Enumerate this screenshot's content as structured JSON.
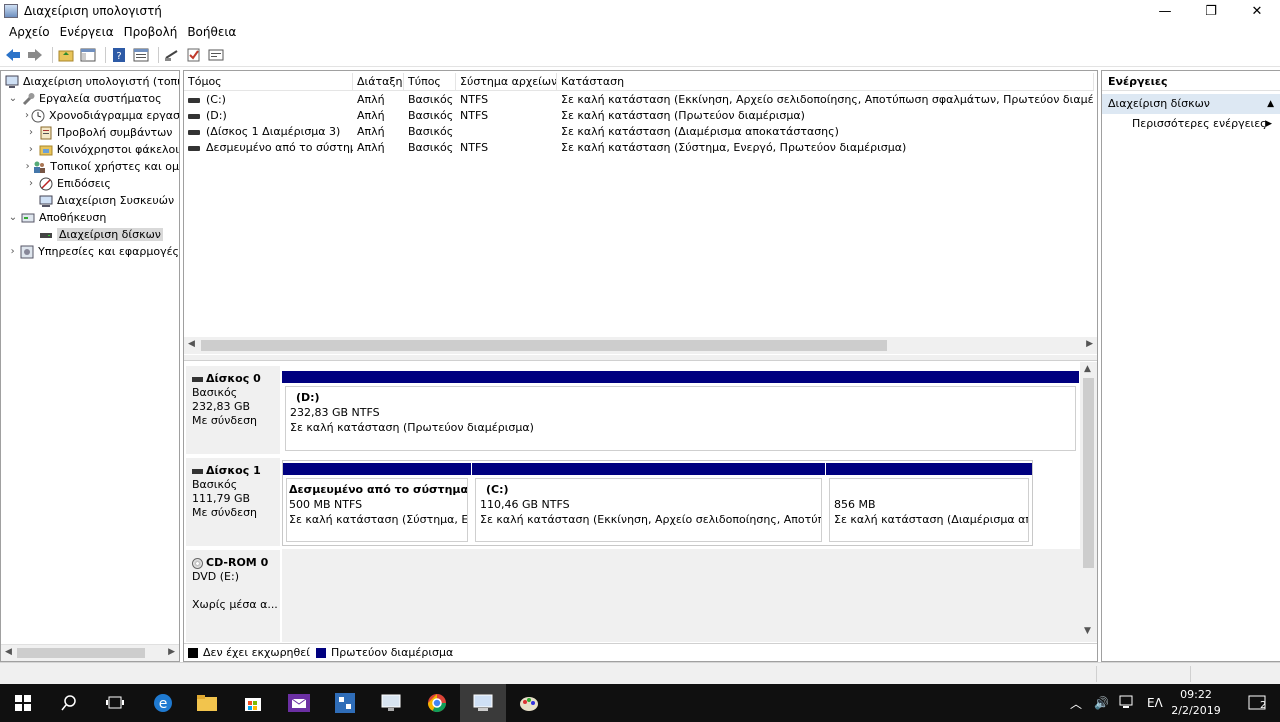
{
  "window": {
    "title": "Διαχείριση υπολογιστή",
    "minimize": "—",
    "maximize": "❐",
    "close": "✕"
  },
  "menu": [
    "Αρχείο",
    "Ενέργεια",
    "Προβολή",
    "Βοήθεια"
  ],
  "tree": {
    "root": "Διαχείριση υπολογιστή (τοπικ",
    "system_tools": "Εργαλεία συστήματος",
    "task_scheduler": "Χρονοδιάγραμμα εργασ",
    "event_viewer": "Προβολή συμβάντων",
    "shared_folders": "Κοινόχρηστοι φάκελοι",
    "local_users": "Τοπικοί χρήστες και ομ",
    "performance": "Επιδόσεις",
    "device_manager": "Διαχείριση Συσκευών",
    "storage": "Αποθήκευση",
    "disk_management": "Διαχείριση δίσκων",
    "services": "Υπηρεσίες και εφαρμογές"
  },
  "list": {
    "headers": [
      "Τόμος",
      "Διάταξη",
      "Τύπος",
      "Σύστημα αρχείων",
      "Κατάσταση"
    ],
    "rows": [
      [
        "(C:)",
        "Απλή",
        "Βασικός",
        "NTFS",
        "Σε καλή κατάσταση (Εκκίνηση, Αρχείο σελιδοποίησης, Αποτύπωση σφαλμάτων, Πρωτεύον διαμέρισμα)"
      ],
      [
        "(D:)",
        "Απλή",
        "Βασικός",
        "NTFS",
        "Σε καλή κατάσταση (Πρωτεύον διαμέρισμα)"
      ],
      [
        "(Δίσκος 1 Διαμέρισμα 3)",
        "Απλή",
        "Βασικός",
        "",
        "Σε καλή κατάσταση (Διαμέρισμα αποκατάστασης)"
      ],
      [
        "Δεσμευμένο από το σύστημα",
        "Απλή",
        "Βασικός",
        "NTFS",
        "Σε καλή κατάσταση (Σύστημα, Ενεργό, Πρωτεύον διαμέρισμα)"
      ]
    ]
  },
  "disks": {
    "disk0": {
      "name": "Δίσκος 0",
      "type": "Βασικός",
      "size": "232,83 GB",
      "status": "Με σύνδεση",
      "p1": {
        "title": "(D:)",
        "size": "232,83 GB NTFS",
        "status": "Σε καλή κατάσταση (Πρωτεύον διαμέρισμα)"
      }
    },
    "disk1": {
      "name": "Δίσκος 1",
      "type": "Βασικός",
      "size": "111,79 GB",
      "status": "Με σύνδεση",
      "p1": {
        "title": "Δεσμευμένο από το σύστημα",
        "size": "500 MB NTFS",
        "status": "Σε καλή κατάσταση (Σύστημα, Ενερ"
      },
      "p2": {
        "title": "(C:)",
        "size": "110,46 GB NTFS",
        "status": "Σε καλή κατάσταση (Εκκίνηση, Αρχείο σελιδοποίησης, Αποτύπωση"
      },
      "p3": {
        "size": "856 MB",
        "status": "Σε καλή κατάσταση (Διαμέρισμα αποκ"
      }
    },
    "cdrom": {
      "name": "CD-ROM 0",
      "drive": "DVD (E:)",
      "status": "Χωρίς μέσα α..."
    }
  },
  "legend": {
    "unallocated": "Δεν έχει εκχωρηθεί",
    "primary": "Πρωτεύον διαμέρισμα",
    "unallocated_color": "#000000",
    "primary_color": "#00007f"
  },
  "actions": {
    "header": "Ενέργειες",
    "section": "Διαχείριση δίσκων",
    "more": "Περισσότερες ενέργειες"
  },
  "taskbar": {
    "time": "09:22",
    "date": "2/2/2019",
    "lang": "ΕΛ",
    "notifications": "2"
  }
}
